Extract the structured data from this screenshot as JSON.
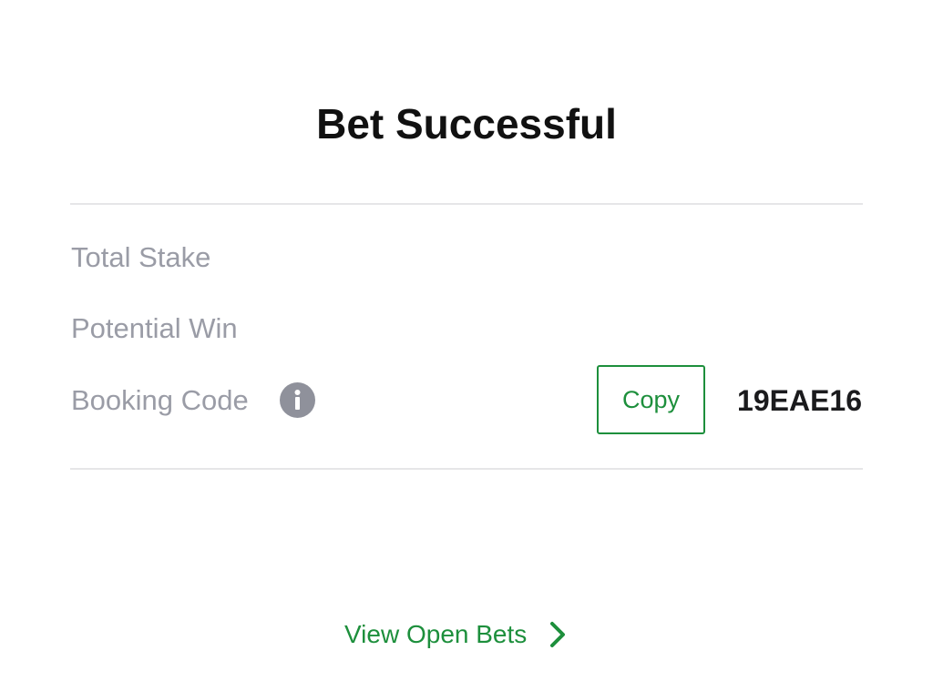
{
  "dialog": {
    "title": "Bet Successful"
  },
  "summary": {
    "total_stake_label": "Total Stake",
    "potential_win_label": "Potential Win",
    "booking_code_label": "Booking Code",
    "copy_label": "Copy",
    "booking_code_value": "19EAE16"
  },
  "footer": {
    "view_open_bets_label": "View Open Bets"
  },
  "icons": {
    "info": "info-icon",
    "chevron": "chevron-right-icon"
  },
  "colors": {
    "accent": "#1d8f3c",
    "muted_text": "#9a9ca6",
    "title_text": "#111111"
  }
}
